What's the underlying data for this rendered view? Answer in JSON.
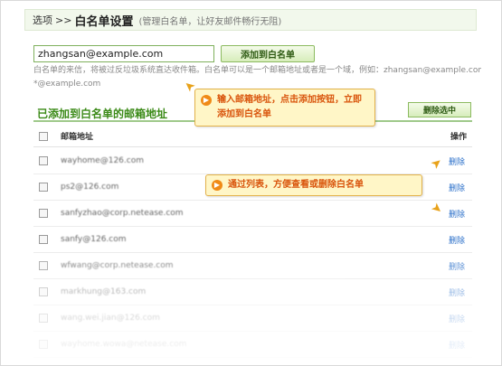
{
  "header": {
    "crumb": "选项",
    "separator": ">>",
    "title": "白名单设置",
    "note": "(管理白名单，让好友邮件畅行无阻)"
  },
  "form": {
    "email_value": "zhangsan@example.com",
    "add_button_label": "添加到白名单",
    "help_line1": "白名单的来信，将被过反垃圾系统直达收件箱。白名单可以是一个邮箱地址或者是一个域，例如：zhangsan@example.com",
    "help_line2": "*@example.com"
  },
  "list": {
    "section_title": "已添加到白名单的邮箱地址",
    "delete_selected_label": "删除选中",
    "col_address": "邮箱地址",
    "col_action": "操作",
    "delete_label": "删除",
    "rows": [
      "wayhome@126.com",
      "ps2@126.com",
      "sanfyzhao@corp.netease.com",
      "sanfy@126.com",
      "wfwang@corp.netease.com",
      "markhung@163.com",
      "wang.wei.jian@126.com",
      "wayhome.wowa@netease.com"
    ]
  },
  "callouts": {
    "tip1": "输入邮箱地址，点击添加按钮，立即添加到白名单",
    "tip2": "通过列表，方便查看或删除白名单"
  },
  "colors": {
    "accent_green": "#3b8a17",
    "link_blue": "#2a6fc9",
    "callout_orange": "#d9540b",
    "callout_bg": "#fff6c7"
  }
}
